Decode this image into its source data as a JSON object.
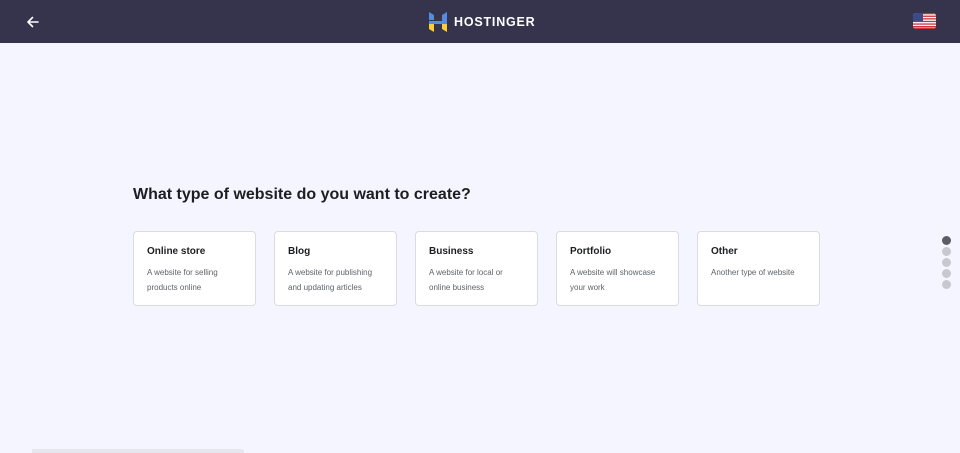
{
  "header": {
    "back_icon": "arrow-left-icon",
    "logo_text": "HOSTINGER",
    "logo_icon": "hostinger-logo-icon",
    "language_icon": "us-flag-icon",
    "background_color": "#36344d"
  },
  "main": {
    "question": "What type of website do you want to create?",
    "options": [
      {
        "title": "Online store",
        "description": "A website for selling products online"
      },
      {
        "title": "Blog",
        "description": "A website for publishing and updating articles"
      },
      {
        "title": "Business",
        "description": "A website for local or online business"
      },
      {
        "title": "Portfolio",
        "description": "A website will showcase your work"
      },
      {
        "title": "Other",
        "description": "Another type of website"
      }
    ]
  },
  "progress": {
    "total_steps": 5,
    "current_step": 1
  },
  "colors": {
    "page_background": "#f4f5ff",
    "logo_blue": "#4f8ee0",
    "logo_yellow": "#ffcd35"
  }
}
